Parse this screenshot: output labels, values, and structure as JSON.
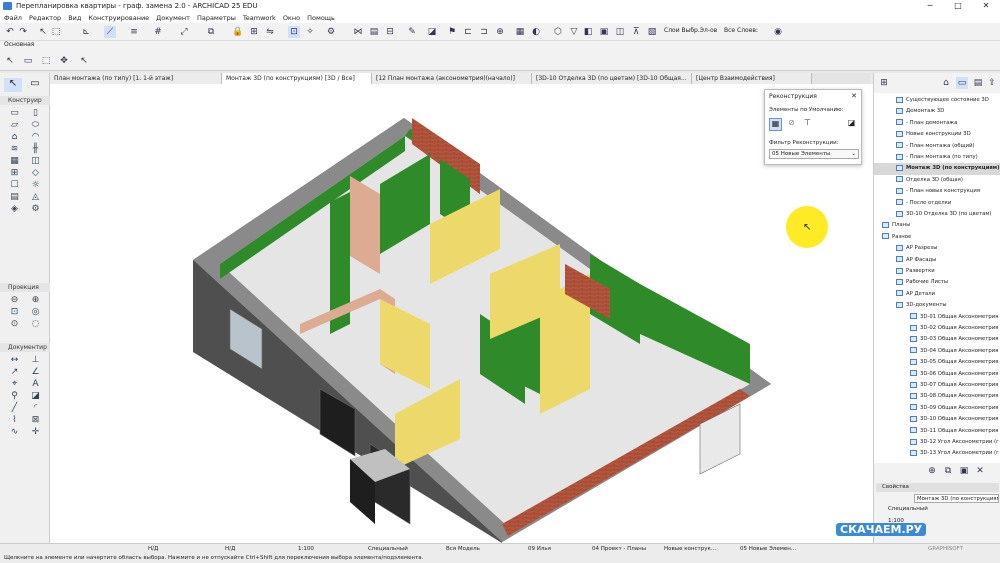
{
  "window": {
    "title": "Перепланировка квартиры - граф. замена 2.0 - ARCHICAD 25 EDU",
    "min": "─",
    "max": "□",
    "close": "✕"
  },
  "menu": [
    "Файл",
    "Редактор",
    "Вид",
    "Конструирование",
    "Документ",
    "Параметры",
    "Teamwork",
    "Окно",
    "Помощь"
  ],
  "toolbar": {
    "layers_label": "Слои Выбр.Эл-ов",
    "layers2_label": "Все Слоев:",
    "info_label": "Основная"
  },
  "toolbox": {
    "sections": [
      "Конструир",
      "Проекция",
      "Документир"
    ]
  },
  "tabs": [
    {
      "label": "План монтажа (по типу) [1. 1-й этаж]",
      "active": false
    },
    {
      "label": "Монтаж 3D (по конструкциям) [3D / Все]",
      "active": true
    },
    {
      "label": "[12 План монтажа (аксонометрия)(начало)]",
      "active": false
    },
    {
      "label": "[3D-10 Отделка 3D (по цветам) [3D-10 Общая...",
      "active": false
    },
    {
      "label": "[Центр Взаимодействия]",
      "active": false
    }
  ],
  "reno_panel": {
    "title": "Реконструкция",
    "default_label": "Элементы по Умолчанию:",
    "filter_label": "Фильтр Реконструкции:",
    "filter_value": "05 Новые Элементы"
  },
  "navigator": {
    "items": [
      {
        "label": "Существующее состояние 3D",
        "depth": 1,
        "sel": false
      },
      {
        "label": "Демонтаж 3D",
        "depth": 1,
        "sel": false
      },
      {
        "label": "- План демонтажа",
        "depth": 1,
        "sel": false
      },
      {
        "label": "Новые конструкции 3D",
        "depth": 1,
        "sel": false
      },
      {
        "label": "- План монтажа (общий)",
        "depth": 1,
        "sel": false
      },
      {
        "label": "- План монтажа (по типу)",
        "depth": 1,
        "sel": false
      },
      {
        "label": "Монтаж 3D (по конструкциям)",
        "depth": 1,
        "sel": true
      },
      {
        "label": "Отделка 3D (общая)",
        "depth": 1,
        "sel": false
      },
      {
        "label": "- План новых конструкция",
        "depth": 1,
        "sel": false
      },
      {
        "label": "- После отделки",
        "depth": 1,
        "sel": false
      },
      {
        "label": "3D-10 Отделка 3D (по цветам)",
        "depth": 1,
        "sel": false
      },
      {
        "label": "Планы",
        "depth": 0,
        "sel": false
      },
      {
        "label": "Разное",
        "depth": 0,
        "sel": false
      },
      {
        "label": "АР Разрезы",
        "depth": 1,
        "sel": false
      },
      {
        "label": "АР Фасады",
        "depth": 1,
        "sel": false
      },
      {
        "label": "Развертки",
        "depth": 1,
        "sel": false
      },
      {
        "label": "Рабочие Листы",
        "depth": 1,
        "sel": false
      },
      {
        "label": "АР Детали",
        "depth": 1,
        "sel": false
      },
      {
        "label": "3D-документы",
        "depth": 1,
        "sel": false
      },
      {
        "label": "3D-01 Общая Аксонометрия",
        "depth": 2,
        "sel": false
      },
      {
        "label": "3D-02 Общая Аксонометрия",
        "depth": 2,
        "sel": false
      },
      {
        "label": "3D-03 Общая Аксонометрия",
        "depth": 2,
        "sel": false
      },
      {
        "label": "3D-04 Общая Аксонометрия",
        "depth": 2,
        "sel": false
      },
      {
        "label": "3D-05 Общая Аксонометрия",
        "depth": 2,
        "sel": false
      },
      {
        "label": "3D-06 Общая Аксонометрия",
        "depth": 2,
        "sel": false
      },
      {
        "label": "3D-07 Общая Аксонометрия",
        "depth": 2,
        "sel": false
      },
      {
        "label": "3D-08 Общая Аксонометрия",
        "depth": 2,
        "sel": false
      },
      {
        "label": "3D-09 Общая Аксонометрия",
        "depth": 2,
        "sel": false
      },
      {
        "label": "3D-10 Общая Аксонометрия",
        "depth": 2,
        "sel": false
      },
      {
        "label": "3D-11 Общая Аксонометрия",
        "depth": 2,
        "sel": false
      },
      {
        "label": "3D-12 Угол Аксонометрии (г",
        "depth": 2,
        "sel": false
      },
      {
        "label": "3D-13 Угол Аксонометрии (г",
        "depth": 2,
        "sel": false
      }
    ]
  },
  "properties": {
    "title": "Свойства",
    "view_name": "Монтаж 3D (по конструкциям)",
    "special": "Специальный",
    "scale": "1:100"
  },
  "status": {
    "nd1": "Н/Д",
    "nd2": "Н/Д",
    "scale": "1:100",
    "special": "Специальный",
    "model": "Вся Модель",
    "user": "09 Илья",
    "plan": "04 Проект - Планы",
    "newc": "Новые конструк...",
    "newe": "05 Новые Элемен...",
    "brand": "GRAPHISOFT"
  },
  "hint": "Щелкните на элементе или начертите область выбора. Нажмите и не отпускайте Ctrl+Shift для переключения выбора элемента/подэлемента.",
  "watermark": "СКАЧАЕМ.РУ",
  "colors": {
    "wall_green": "#2f8a2a",
    "wall_yellow": "#ecd96a",
    "wall_pink": "#dcab92",
    "floor": "#e5e5e5",
    "outer_wall": "#4f4f4f",
    "brick": "#b5553d"
  }
}
